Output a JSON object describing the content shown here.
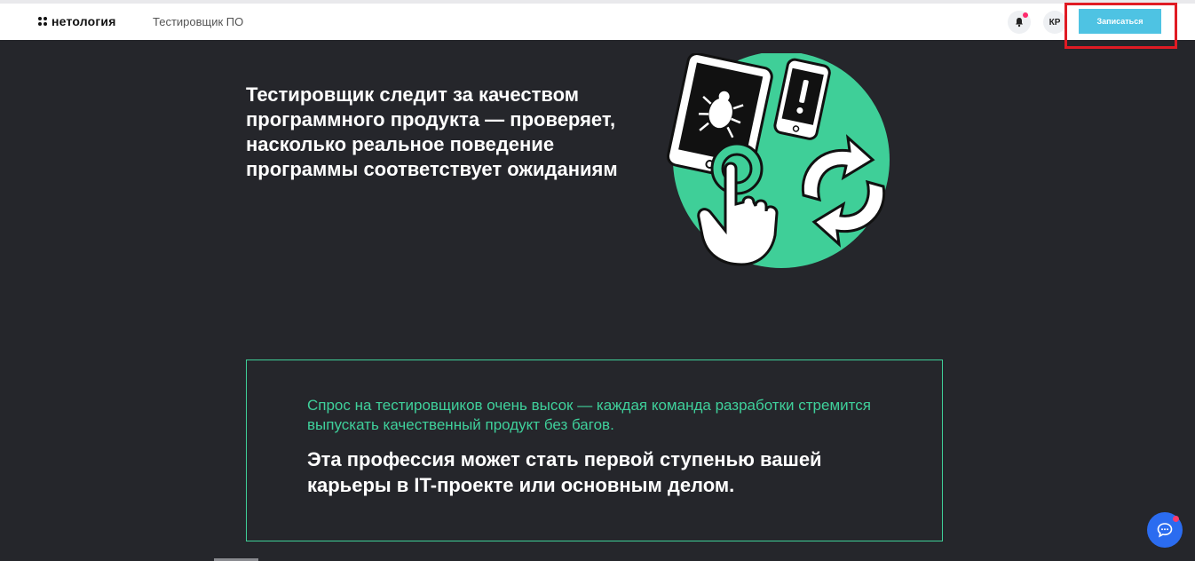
{
  "header": {
    "logo_text": "нетология",
    "course_title": "Тестировщик ПО",
    "user_initials": "КР",
    "signup_label": "Записаться"
  },
  "hero": {
    "heading": "Тестировщик следит за качеством программного продукта — проверяет, насколько реальное поведение программы соответствует ожиданиям"
  },
  "info": {
    "accent_text": "Спрос на тестировщиков очень высок — каждая команда разработки стремится выпускать качественный продукт без багов.",
    "main_text": "Эта профессия может стать первой ступенью вашей карьеры в IT-проекте или основным делом."
  },
  "icons": {
    "bell": "bell-icon",
    "chat": "chat-icon",
    "logo": "logo-icon"
  },
  "colors": {
    "background": "#25262b",
    "accent_green": "#3fd09b",
    "button_blue": "#4ec3e3",
    "chat_blue": "#2b6cf0",
    "highlight_red": "#e01b24"
  }
}
